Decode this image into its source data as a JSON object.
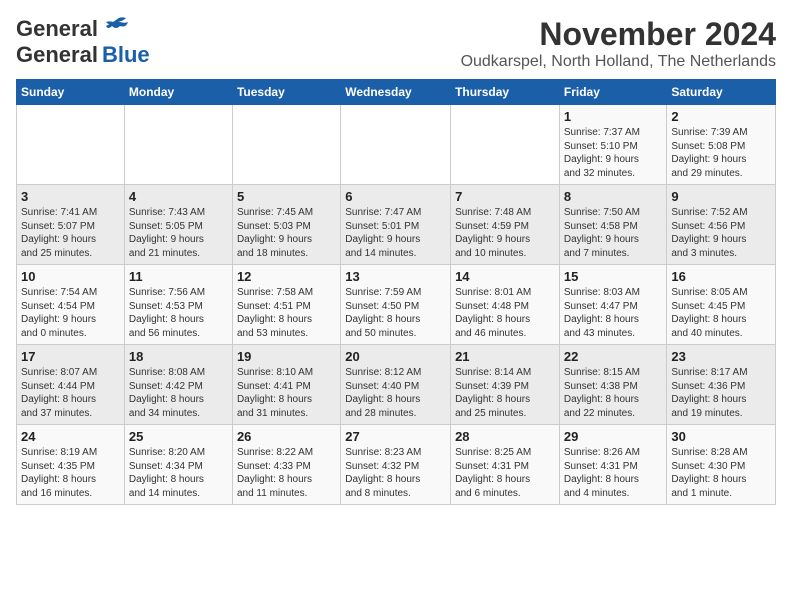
{
  "logo": {
    "line1": "General",
    "line2": "Blue"
  },
  "title": "November 2024",
  "subtitle": "Oudkarspel, North Holland, The Netherlands",
  "weekdays": [
    "Sunday",
    "Monday",
    "Tuesday",
    "Wednesday",
    "Thursday",
    "Friday",
    "Saturday"
  ],
  "weeks": [
    [
      {
        "day": "",
        "info": ""
      },
      {
        "day": "",
        "info": ""
      },
      {
        "day": "",
        "info": ""
      },
      {
        "day": "",
        "info": ""
      },
      {
        "day": "",
        "info": ""
      },
      {
        "day": "1",
        "info": "Sunrise: 7:37 AM\nSunset: 5:10 PM\nDaylight: 9 hours\nand 32 minutes."
      },
      {
        "day": "2",
        "info": "Sunrise: 7:39 AM\nSunset: 5:08 PM\nDaylight: 9 hours\nand 29 minutes."
      }
    ],
    [
      {
        "day": "3",
        "info": "Sunrise: 7:41 AM\nSunset: 5:07 PM\nDaylight: 9 hours\nand 25 minutes."
      },
      {
        "day": "4",
        "info": "Sunrise: 7:43 AM\nSunset: 5:05 PM\nDaylight: 9 hours\nand 21 minutes."
      },
      {
        "day": "5",
        "info": "Sunrise: 7:45 AM\nSunset: 5:03 PM\nDaylight: 9 hours\nand 18 minutes."
      },
      {
        "day": "6",
        "info": "Sunrise: 7:47 AM\nSunset: 5:01 PM\nDaylight: 9 hours\nand 14 minutes."
      },
      {
        "day": "7",
        "info": "Sunrise: 7:48 AM\nSunset: 4:59 PM\nDaylight: 9 hours\nand 10 minutes."
      },
      {
        "day": "8",
        "info": "Sunrise: 7:50 AM\nSunset: 4:58 PM\nDaylight: 9 hours\nand 7 minutes."
      },
      {
        "day": "9",
        "info": "Sunrise: 7:52 AM\nSunset: 4:56 PM\nDaylight: 9 hours\nand 3 minutes."
      }
    ],
    [
      {
        "day": "10",
        "info": "Sunrise: 7:54 AM\nSunset: 4:54 PM\nDaylight: 9 hours\nand 0 minutes."
      },
      {
        "day": "11",
        "info": "Sunrise: 7:56 AM\nSunset: 4:53 PM\nDaylight: 8 hours\nand 56 minutes."
      },
      {
        "day": "12",
        "info": "Sunrise: 7:58 AM\nSunset: 4:51 PM\nDaylight: 8 hours\nand 53 minutes."
      },
      {
        "day": "13",
        "info": "Sunrise: 7:59 AM\nSunset: 4:50 PM\nDaylight: 8 hours\nand 50 minutes."
      },
      {
        "day": "14",
        "info": "Sunrise: 8:01 AM\nSunset: 4:48 PM\nDaylight: 8 hours\nand 46 minutes."
      },
      {
        "day": "15",
        "info": "Sunrise: 8:03 AM\nSunset: 4:47 PM\nDaylight: 8 hours\nand 43 minutes."
      },
      {
        "day": "16",
        "info": "Sunrise: 8:05 AM\nSunset: 4:45 PM\nDaylight: 8 hours\nand 40 minutes."
      }
    ],
    [
      {
        "day": "17",
        "info": "Sunrise: 8:07 AM\nSunset: 4:44 PM\nDaylight: 8 hours\nand 37 minutes."
      },
      {
        "day": "18",
        "info": "Sunrise: 8:08 AM\nSunset: 4:42 PM\nDaylight: 8 hours\nand 34 minutes."
      },
      {
        "day": "19",
        "info": "Sunrise: 8:10 AM\nSunset: 4:41 PM\nDaylight: 8 hours\nand 31 minutes."
      },
      {
        "day": "20",
        "info": "Sunrise: 8:12 AM\nSunset: 4:40 PM\nDaylight: 8 hours\nand 28 minutes."
      },
      {
        "day": "21",
        "info": "Sunrise: 8:14 AM\nSunset: 4:39 PM\nDaylight: 8 hours\nand 25 minutes."
      },
      {
        "day": "22",
        "info": "Sunrise: 8:15 AM\nSunset: 4:38 PM\nDaylight: 8 hours\nand 22 minutes."
      },
      {
        "day": "23",
        "info": "Sunrise: 8:17 AM\nSunset: 4:36 PM\nDaylight: 8 hours\nand 19 minutes."
      }
    ],
    [
      {
        "day": "24",
        "info": "Sunrise: 8:19 AM\nSunset: 4:35 PM\nDaylight: 8 hours\nand 16 minutes."
      },
      {
        "day": "25",
        "info": "Sunrise: 8:20 AM\nSunset: 4:34 PM\nDaylight: 8 hours\nand 14 minutes."
      },
      {
        "day": "26",
        "info": "Sunrise: 8:22 AM\nSunset: 4:33 PM\nDaylight: 8 hours\nand 11 minutes."
      },
      {
        "day": "27",
        "info": "Sunrise: 8:23 AM\nSunset: 4:32 PM\nDaylight: 8 hours\nand 8 minutes."
      },
      {
        "day": "28",
        "info": "Sunrise: 8:25 AM\nSunset: 4:31 PM\nDaylight: 8 hours\nand 6 minutes."
      },
      {
        "day": "29",
        "info": "Sunrise: 8:26 AM\nSunset: 4:31 PM\nDaylight: 8 hours\nand 4 minutes."
      },
      {
        "day": "30",
        "info": "Sunrise: 8:28 AM\nSunset: 4:30 PM\nDaylight: 8 hours\nand 1 minute."
      }
    ]
  ]
}
